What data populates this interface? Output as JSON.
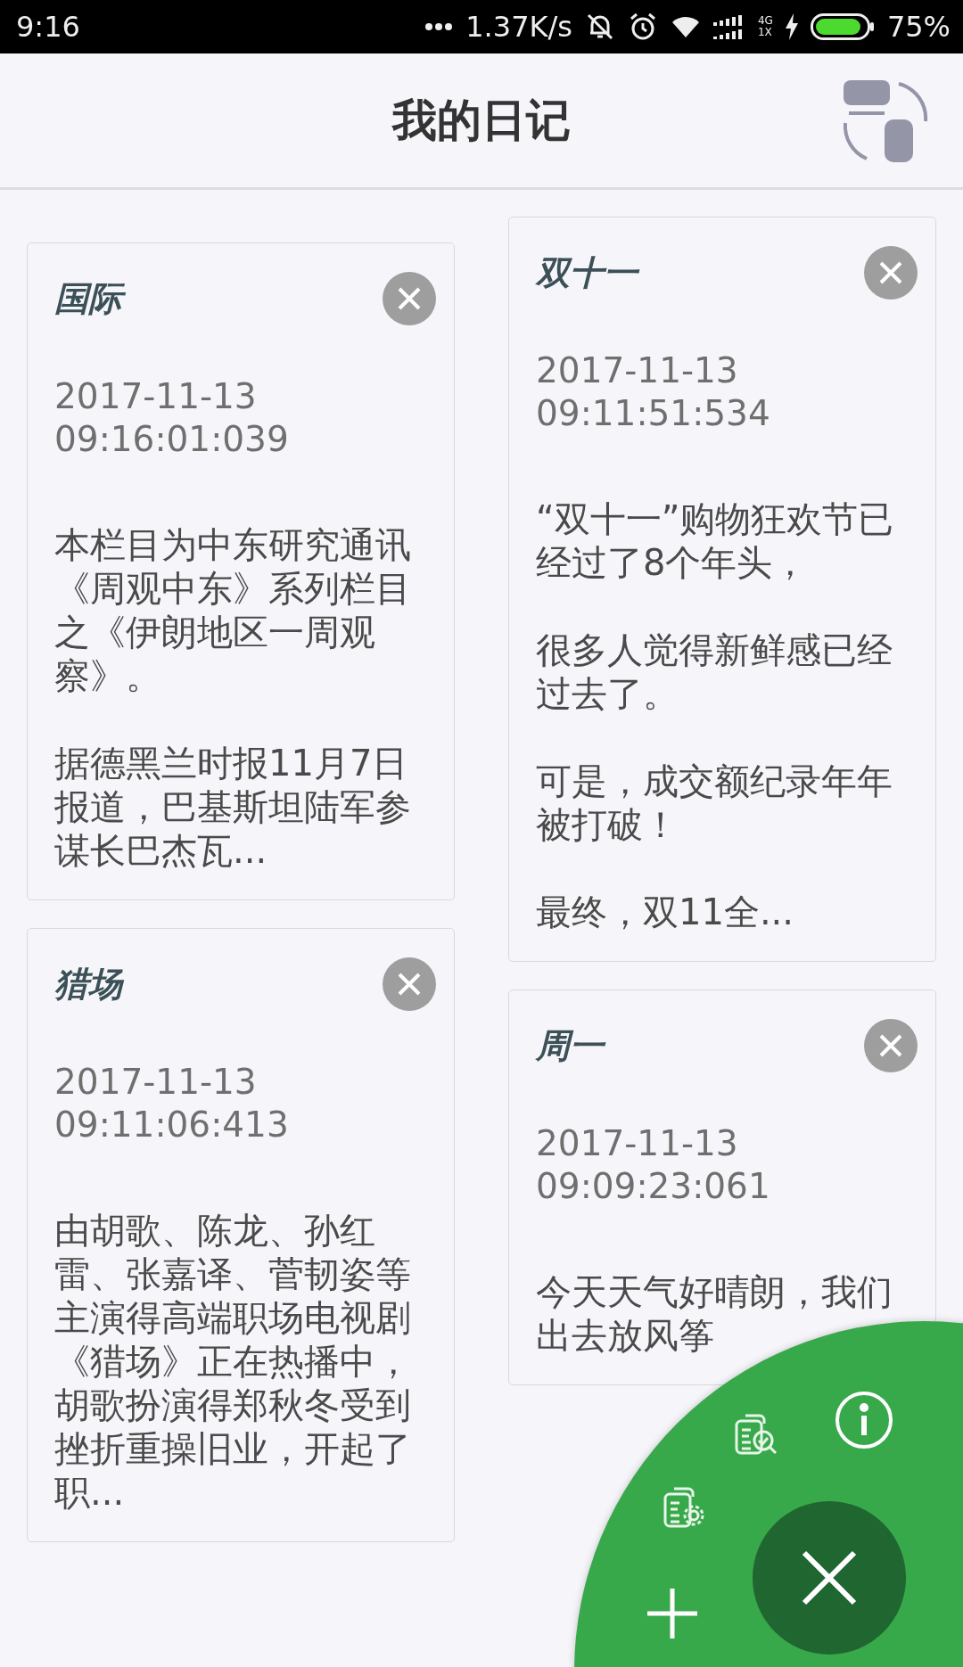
{
  "status_bar": {
    "time": "9:16",
    "speed": "1.37K/s",
    "network_type": "4G",
    "network_sub": "1X",
    "battery": "75%"
  },
  "header": {
    "title": "我的日记"
  },
  "columns": [
    {
      "notes": [
        {
          "title": "国际",
          "date": "2017-11-13",
          "time": "09:16:01:039",
          "paragraphs": [
            "本栏目为中东研究通讯《周观中东》系列栏目之《伊朗地区一周观察》。",
            "据德黑兰时报11月7日报道，巴基斯坦陆军参谋长巴杰瓦..."
          ]
        },
        {
          "title": "猎场",
          "date": "2017-11-13",
          "time": "09:11:06:413",
          "paragraphs": [
            "由胡歌、陈龙、孙红雷、张嘉译、菅韧姿等主演得高端职场电视剧《猎场》正在热播中，胡歌扮演得郑秋冬受到挫折重操旧业，开起了职..."
          ]
        }
      ]
    },
    {
      "notes": [
        {
          "title": "双十一",
          "date": "2017-11-13",
          "time": "09:11:51:534",
          "paragraphs": [
            "“双十一”购物狂欢节已经过了8个年头，",
            "很多人觉得新鲜感已经过去了。",
            "可是，成交额纪录年年被打破！",
            "最终，双11全..."
          ]
        },
        {
          "title": "周一",
          "date": "2017-11-13",
          "time": "09:09:23:061",
          "paragraphs": [
            "今天天气好晴朗，我们出去放风筝"
          ]
        }
      ]
    }
  ],
  "fab": {
    "expanded": true
  }
}
